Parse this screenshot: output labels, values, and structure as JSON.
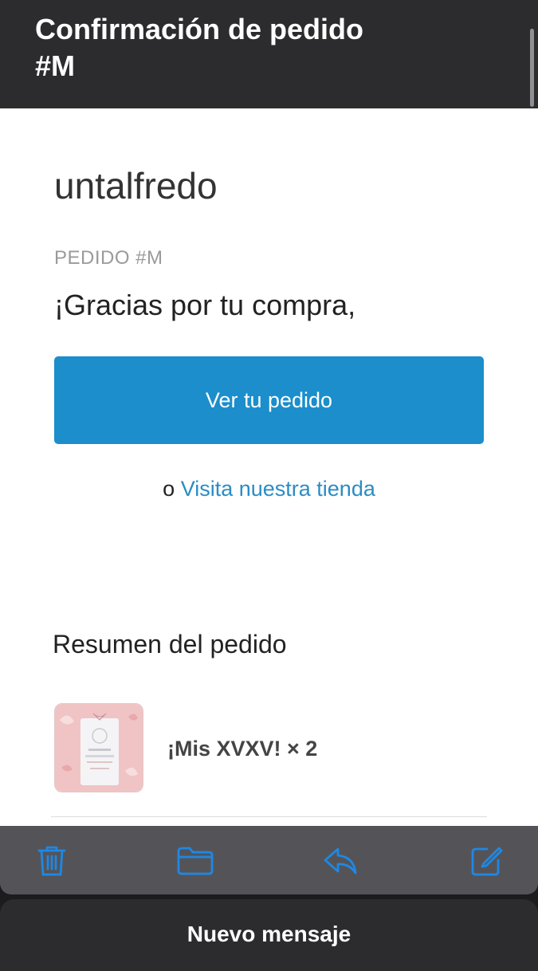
{
  "header": {
    "title": "Confirmación de pedido\n#M"
  },
  "email": {
    "store_name": "untalfredo",
    "order_label": "PEDIDO #M",
    "thanks_text": "¡Gracias por tu compra,",
    "view_order_button": "Ver tu pedido",
    "link_prefix": "o",
    "store_link": "Visita nuestra tienda",
    "summary_title": "Resumen del pedido",
    "items": [
      {
        "name": "¡Mis XVXV! × 2"
      }
    ]
  },
  "toolbar": {
    "icons": [
      "trash-icon",
      "folder-icon",
      "reply-icon",
      "compose-icon"
    ],
    "accent_color": "#1e88e5"
  },
  "bottom_bar": {
    "label": "Nuevo mensaje"
  },
  "colors": {
    "button_blue": "#1b8ecb",
    "link_blue": "#2b8cc4",
    "header_bg": "#2c2c2e"
  }
}
